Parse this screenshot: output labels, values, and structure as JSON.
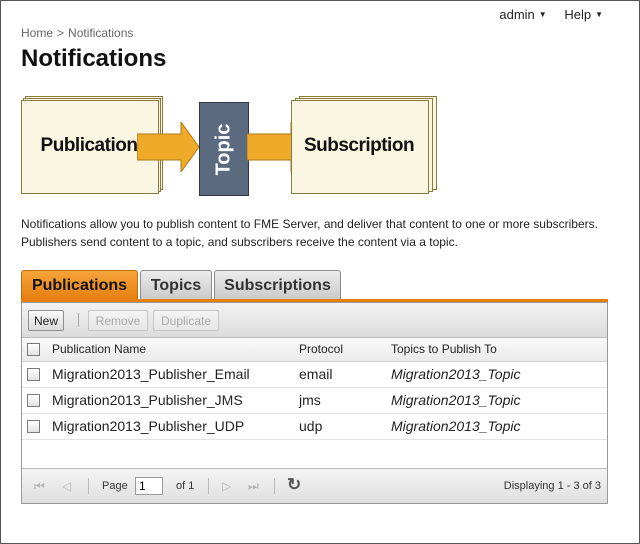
{
  "topmenu": {
    "user": "admin",
    "help": "Help"
  },
  "breadcrumb": {
    "home": "Home",
    "separator": ">",
    "current": "Notifications"
  },
  "page_title": "Notifications",
  "diagram": {
    "publication": "Publication",
    "topic": "Topic",
    "subscription": "Subscription"
  },
  "description": "Notifications allow you to publish content to FME Server, and deliver that content to one or more subscribers. Publishers send content to a topic, and subscribers receive the content via a topic.",
  "tabs": [
    {
      "label": "Publications",
      "active": true
    },
    {
      "label": "Topics",
      "active": false
    },
    {
      "label": "Subscriptions",
      "active": false
    }
  ],
  "toolbar": {
    "new": "New",
    "remove": "Remove",
    "duplicate": "Duplicate"
  },
  "table": {
    "columns": [
      "Publication Name",
      "Protocol",
      "Topics to Publish To"
    ],
    "rows": [
      {
        "name": "Migration2013_Publisher_Email",
        "protocol": "email",
        "topic": "Migration2013_Topic"
      },
      {
        "name": "Migration2013_Publisher_JMS",
        "protocol": "jms",
        "topic": "Migration2013_Topic"
      },
      {
        "name": "Migration2013_Publisher_UDP",
        "protocol": "udp",
        "topic": "Migration2013_Topic"
      }
    ]
  },
  "pager": {
    "page_label": "Page",
    "page_value": "1",
    "of_label": "of 1",
    "displaying": "Displaying 1 - 3 of 3"
  },
  "colors": {
    "accent": "#e57f10",
    "topic_box": "#5c6a80",
    "arrow": "#f0aa2a",
    "page_bg": "#fbf6e2"
  }
}
